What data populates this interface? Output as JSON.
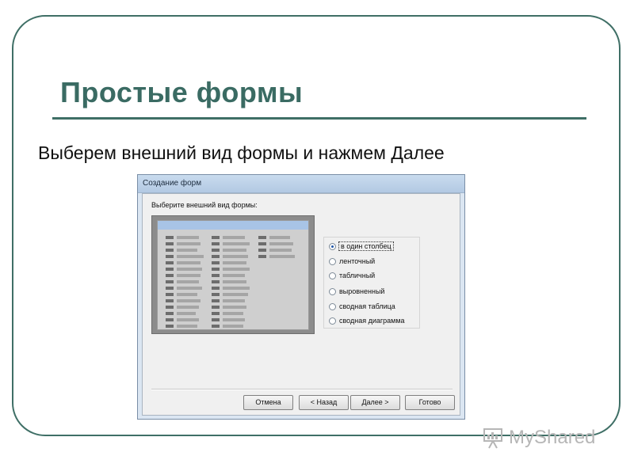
{
  "slide": {
    "title": "Простые формы",
    "subtitle": "Выберем внешний вид формы и нажмем Далее"
  },
  "dialog": {
    "title": "Создание форм",
    "prompt": "Выберите внешний вид формы:",
    "options": [
      {
        "label": "в один столбец",
        "selected": true
      },
      {
        "label": "ленточный",
        "selected": false
      },
      {
        "label": "табличный",
        "selected": false
      },
      {
        "label": "выровненный",
        "selected": false
      },
      {
        "label": "сводная таблица",
        "selected": false
      },
      {
        "label": "сводная диаграмма",
        "selected": false
      }
    ],
    "buttons": {
      "cancel": "Отмена",
      "back": "< Назад",
      "next": "Далее >",
      "finish": "Готово"
    }
  },
  "watermark": {
    "text": "MyShared"
  },
  "colors": {
    "accent": "#3a6b63",
    "frame": "#3f6f66"
  }
}
